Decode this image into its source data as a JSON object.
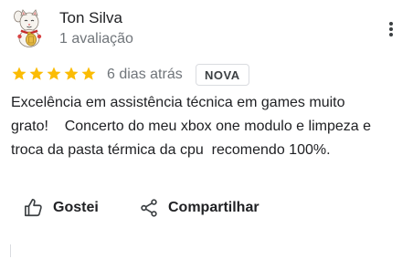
{
  "review": {
    "author": {
      "name": "Ton Silva",
      "meta": "1 avaliação",
      "avatar_icon": "lucky-cat-avatar"
    },
    "rating": 5,
    "rating_max": 5,
    "star_color": "#fbbc04",
    "date": "6 dias atrás",
    "badge": "NOVA",
    "text": "Excelência em assistência técnica em games muito\ngrato!    Concerto do meu xbox one modulo e limpeza e\ntroca da pasta térmica da cpu  recomendo 100%.",
    "actions": {
      "like_label": "Gostei",
      "like_icon": "thumbs-up-icon",
      "share_label": "Compartilhar",
      "share_icon": "share-icon"
    },
    "menu_icon": "more-vert-icon"
  }
}
